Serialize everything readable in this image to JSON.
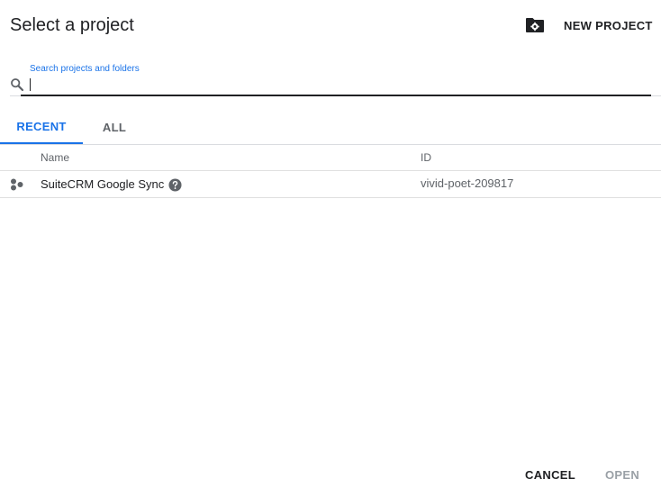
{
  "dialog": {
    "title": "Select a project",
    "new_project_label": "NEW PROJECT",
    "new_project_icon": "folder-settings-icon"
  },
  "search": {
    "label": "Search projects and folders",
    "value": "",
    "placeholder": "",
    "icon": "search-icon"
  },
  "tabs": [
    {
      "label": "RECENT",
      "active": true
    },
    {
      "label": "ALL",
      "active": false
    }
  ],
  "table": {
    "columns": [
      "Name",
      "ID"
    ],
    "rows": [
      {
        "name": "SuiteCRM Google Sync",
        "id": "vivid-poet-209817",
        "icon": "project-dots-icon",
        "help_icon": "help-circle-icon"
      }
    ]
  },
  "footer": {
    "cancel_label": "CANCEL",
    "open_label": "OPEN",
    "open_enabled": false
  },
  "colors": {
    "accent": "#1a73e8",
    "text_primary": "#202124",
    "text_secondary": "#5f6368",
    "disabled": "#9aa0a6",
    "divider": "#dadce0"
  }
}
